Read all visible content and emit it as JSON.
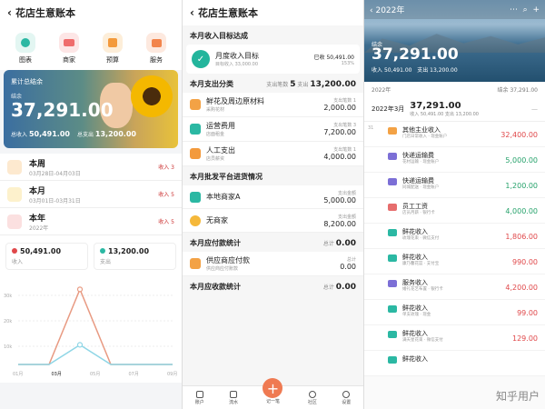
{
  "p1": {
    "title": "花店生意账本",
    "icons": [
      {
        "label": "图表",
        "color": "#2bb8a3"
      },
      {
        "label": "商家",
        "color": "#ef6c6c"
      },
      {
        "label": "预算",
        "color": "#f39a3c"
      },
      {
        "label": "服务",
        "color": "#f2854c"
      }
    ],
    "banner": {
      "label": "累计总结余",
      "sub": "结余",
      "amount": "37,291.00",
      "income_label": "总收入",
      "income": "50,491.00",
      "expense_label": "总支出",
      "expense": "13,200.00"
    },
    "periods": [
      {
        "name": "本周",
        "date": "03月28日-04月03日",
        "right": "收入 3",
        "color": "#f3a245"
      },
      {
        "name": "本月",
        "date": "03月01日-03月31日",
        "right": "收入 5",
        "color": "#f5b83a"
      },
      {
        "name": "本年",
        "date": "2022年",
        "right": "收入 5",
        "color": "#e66d6d"
      }
    ],
    "stats": [
      {
        "value": "50,491.00",
        "label": "收入",
        "color": "#e0484a"
      },
      {
        "value": "13,200.00",
        "label": "支出",
        "color": "#2bb8a3"
      }
    ],
    "chart_data": {
      "type": "line",
      "categories": [
        "01月",
        "02月",
        "03月",
        "04月",
        "05月",
        "06月"
      ],
      "series": [
        {
          "values": [
            0,
            0,
            50491,
            0,
            0,
            0
          ],
          "color": "#e89a82"
        },
        {
          "values": [
            0,
            0,
            13200,
            0,
            0,
            0
          ],
          "color": "#8fd6e6"
        }
      ],
      "tick_labels": [
        "01月",
        "03月",
        "05月",
        "07月",
        "09月"
      ],
      "y_ticks": [
        "30k",
        "20k",
        "10k"
      ],
      "ylim": [
        0,
        55000
      ]
    }
  },
  "p2": {
    "title": "花店生意账本",
    "sec_goal": "本月收入目标达成",
    "goal": {
      "name": "月度收入目标",
      "sub": "目标收入 33,000.00",
      "right": "已收 50,491.00",
      "pct": "153%"
    },
    "sec_exp": "本月支出分类",
    "exp_count_label": "支出笔数",
    "exp_count": "5",
    "exp_total_label": "支出",
    "exp_total": "13,200.00",
    "expenses": [
      {
        "name": "鲜花及周边原材料",
        "sub": "采购花材",
        "small": "支出笔数",
        "count": "1",
        "amount": "2,000.00",
        "color": "#f3a245"
      },
      {
        "name": "运营费用",
        "sub": "店面租金",
        "small": "支出笔数",
        "count": "3",
        "amount": "7,200.00",
        "color": "#2bb8a3"
      },
      {
        "name": "人工支出",
        "sub": "店员薪资",
        "small": "支出笔数",
        "count": "1",
        "amount": "4,000.00",
        "color": "#f39a3c"
      }
    ],
    "sec_partner": "本月批发平台进货情况",
    "partners": [
      {
        "name": "本地商家A",
        "small": "支出金额",
        "amount": "5,000.00",
        "color": "#2bb8a3"
      },
      {
        "name": "无商家",
        "small": "支出金额",
        "amount": "8,200.00",
        "color": "#f5b83a"
      }
    ],
    "sec_payable": "本月应付款统计",
    "payable_total_small": "总计",
    "payable_total": "0.00",
    "payables": [
      {
        "name": "供应商应付款",
        "sub": "供应商应付账款",
        "small": "总计",
        "amount": "0.00",
        "color": "#f3a245"
      }
    ],
    "sec_receivable": "本月应收款统计",
    "receivable_total_small": "总计",
    "receivable_total": "0.00",
    "tabs": [
      {
        "label": "账户"
      },
      {
        "label": "流水"
      },
      {
        "label": "记一笔"
      },
      {
        "label": "社区"
      },
      {
        "label": "设置"
      }
    ]
  },
  "p3": {
    "year": "2022年",
    "hero": {
      "label": "结余",
      "amount": "37,291.00",
      "in_label": "收入",
      "income": "50,491.00",
      "out_label": "支出",
      "expense": "13,200.00"
    },
    "year_row": {
      "left": "2022年",
      "right": "结余 37,291.00"
    },
    "month": {
      "label": "2022年3月",
      "value": "37,291.00",
      "sub_in": "收入 50,491.00",
      "sub_out": "支出 13,200.00"
    },
    "day": "31",
    "items": [
      {
        "name": "其他主业收入",
        "desc": "门店日常收入 · 现金账户",
        "amount": "32,400.00",
        "green": false,
        "color": "#f3a245"
      },
      {
        "name": "快递运输费",
        "desc": "花材运输 · 现金账户",
        "amount": "5,000.00",
        "green": true,
        "color": "#7c6fd6"
      },
      {
        "name": "快递运输费",
        "desc": "同城配送 · 现金账户",
        "amount": "1,200.00",
        "green": true,
        "color": "#7c6fd6"
      },
      {
        "name": "员工工资",
        "desc": "店员月薪 · 银行卡",
        "amount": "4,000.00",
        "green": true,
        "color": "#e66d6d"
      },
      {
        "name": "鲜花收入",
        "desc": "玫瑰花束 · 微信支付",
        "amount": "1,806.00",
        "green": false,
        "color": "#2bb8a3"
      },
      {
        "name": "鲜花收入",
        "desc": "康乃馨花篮 · 支付宝",
        "amount": "990.00",
        "green": false,
        "color": "#2bb8a3"
      },
      {
        "name": "服务收入",
        "desc": "婚礼花艺布置 · 银行卡",
        "amount": "4,200.00",
        "green": false,
        "color": "#7c6fd6"
      },
      {
        "name": "鲜花收入",
        "desc": "单支玫瑰 · 现金",
        "amount": "99.00",
        "green": false,
        "color": "#2bb8a3"
      },
      {
        "name": "鲜花收入",
        "desc": "满天星花束 · 微信支付",
        "amount": "129.00",
        "green": false,
        "color": "#2bb8a3"
      },
      {
        "name": "鲜花收入",
        "desc": "",
        "amount": "",
        "green": false,
        "color": "#2bb8a3"
      }
    ],
    "watermark": "知乎用户"
  }
}
